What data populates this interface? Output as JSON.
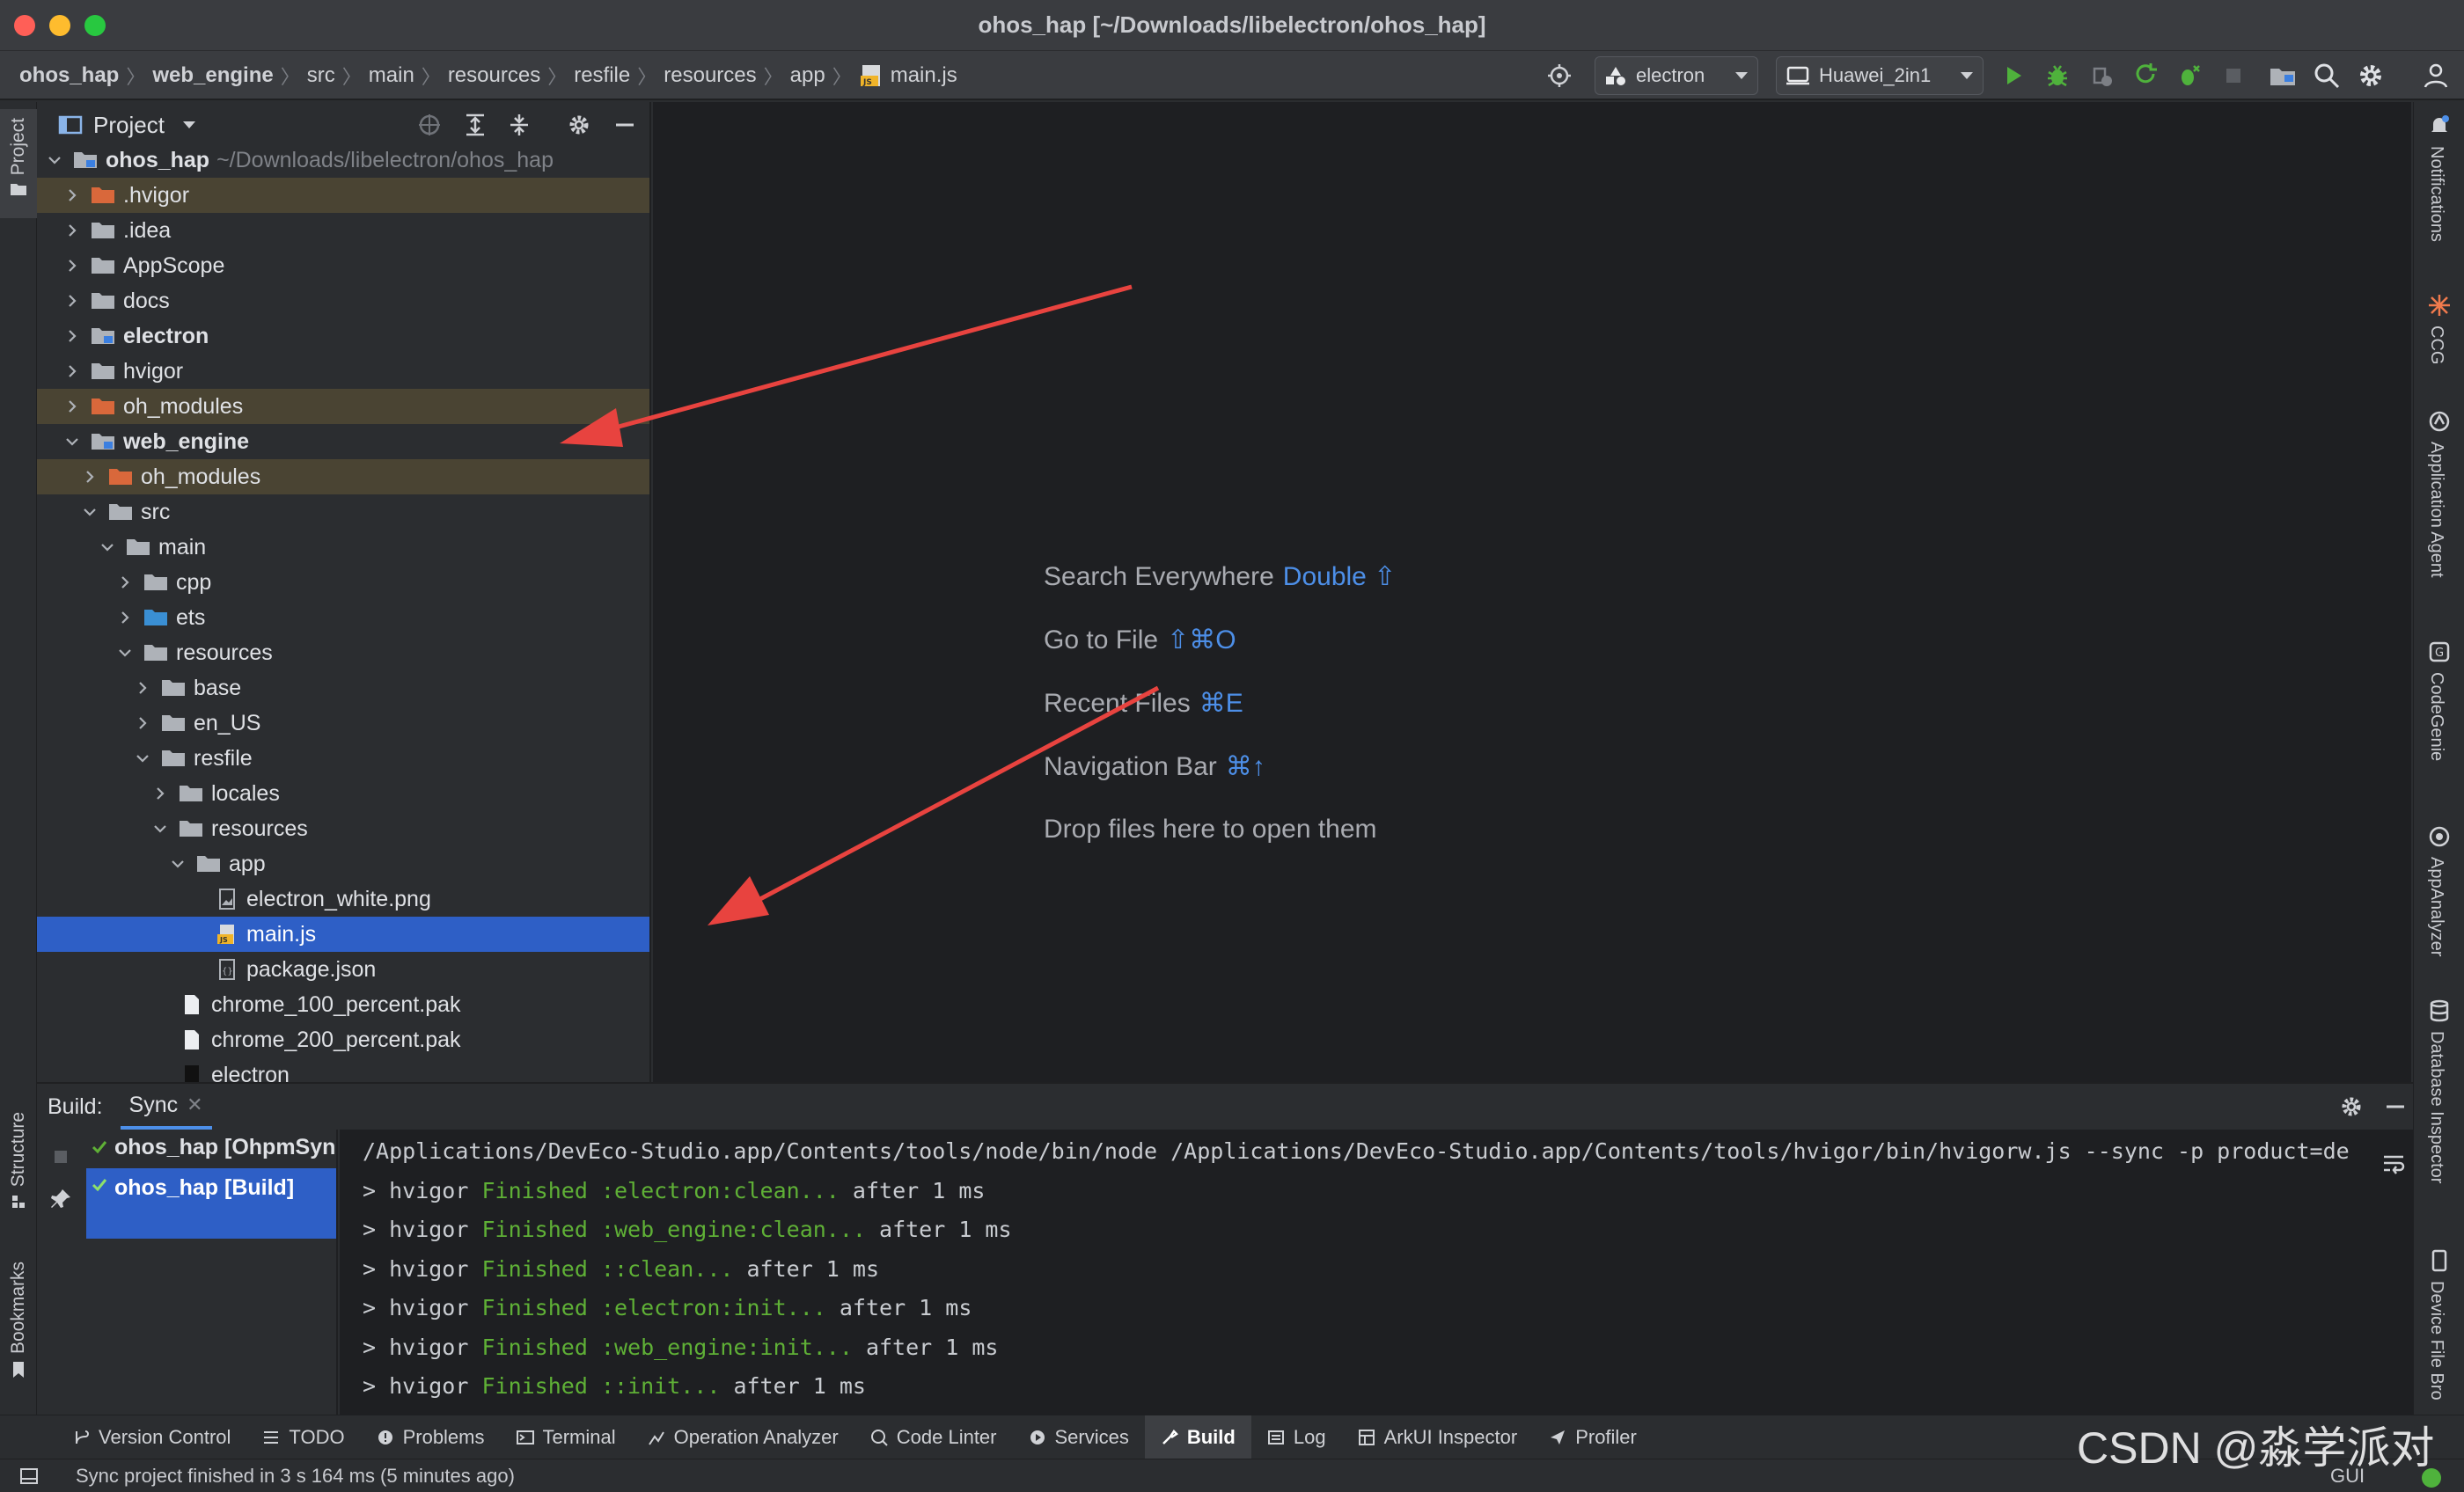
{
  "window": {
    "title": "ohos_hap [~/Downloads/libelectron/ohos_hap]"
  },
  "breadcrumb": [
    "ohos_hap",
    "web_engine",
    "src",
    "main",
    "resources",
    "resfile",
    "resources",
    "app",
    "main.js"
  ],
  "toolbar": {
    "module_combo": "electron",
    "device_combo": "Huawei_2in1"
  },
  "left_stripe": {
    "project": "Project",
    "structure": "Structure",
    "bookmarks": "Bookmarks"
  },
  "project_panel": {
    "title": "Project",
    "tree": [
      {
        "label": "ohos_hap",
        "extra": "~/Downloads/libelectron/ohos_hap",
        "bold": true,
        "expanded": true,
        "kind": "module"
      },
      {
        "label": ".hvigor",
        "kind": "excluded"
      },
      {
        "label": ".idea",
        "kind": "folder"
      },
      {
        "label": "AppScope",
        "kind": "folder"
      },
      {
        "label": "docs",
        "kind": "folder"
      },
      {
        "label": "electron",
        "bold": true,
        "kind": "module"
      },
      {
        "label": "hvigor",
        "kind": "folder"
      },
      {
        "label": "oh_modules",
        "kind": "excluded"
      },
      {
        "label": "web_engine",
        "bold": true,
        "expanded": true,
        "kind": "module"
      },
      {
        "label": "oh_modules",
        "kind": "excluded"
      },
      {
        "label": "src",
        "expanded": true,
        "kind": "folder"
      },
      {
        "label": "main",
        "expanded": true,
        "kind": "folder"
      },
      {
        "label": "cpp",
        "kind": "folder"
      },
      {
        "label": "ets",
        "kind": "source"
      },
      {
        "label": "resources",
        "expanded": true,
        "kind": "folder"
      },
      {
        "label": "base",
        "kind": "folder"
      },
      {
        "label": "en_US",
        "kind": "folder"
      },
      {
        "label": "resfile",
        "expanded": true,
        "kind": "folder"
      },
      {
        "label": "locales",
        "kind": "folder"
      },
      {
        "label": "resources",
        "expanded": true,
        "kind": "folder"
      },
      {
        "label": "app",
        "expanded": true,
        "kind": "folder"
      },
      {
        "label": "electron_white.png",
        "kind": "image"
      },
      {
        "label": "main.js",
        "kind": "js",
        "selected": true
      },
      {
        "label": "package.json",
        "kind": "json"
      },
      {
        "label": "chrome_100_percent.pak",
        "kind": "file"
      },
      {
        "label": "chrome_200_percent.pak",
        "kind": "file"
      },
      {
        "label": "electron",
        "kind": "exec"
      }
    ]
  },
  "editor_hints": [
    {
      "label": "Search Everywhere",
      "shortcut": "Double ⇧"
    },
    {
      "label": "Go to File",
      "shortcut": "⇧⌘O"
    },
    {
      "label": "Recent Files",
      "shortcut": "⌘E"
    },
    {
      "label": "Navigation Bar",
      "shortcut": "⌘↑"
    },
    {
      "label": "Drop files here to open them",
      "shortcut": ""
    }
  ],
  "right_stripe": [
    "Notifications",
    "CCG",
    "Application Agent",
    "CodeGenie",
    "AppAnalyzer",
    "Database Inspector",
    "Device File Bro"
  ],
  "build_panel": {
    "label": "Build:",
    "tab": "Sync",
    "tree": [
      "ohos_hap [OhpmSync]",
      "ohos_hap [Build]"
    ],
    "console": [
      {
        "prefix": "",
        "green": "",
        "rest": "/Applications/DevEco-Studio.app/Contents/tools/node/bin/node /Applications/DevEco-Studio.app/Contents/tools/hvigor/bin/hvigorw.js --sync -p product=de"
      },
      {
        "prefix": "> hvigor ",
        "green": "Finished :electron:clean...",
        "rest": " after 1 ms"
      },
      {
        "prefix": "> hvigor ",
        "green": "Finished :web_engine:clean...",
        "rest": " after 1 ms"
      },
      {
        "prefix": "> hvigor ",
        "green": "Finished ::clean...",
        "rest": " after 1 ms"
      },
      {
        "prefix": "> hvigor ",
        "green": "Finished :electron:init...",
        "rest": " after 1 ms"
      },
      {
        "prefix": "> hvigor ",
        "green": "Finished :web_engine:init...",
        "rest": " after 1 ms"
      },
      {
        "prefix": "> hvigor ",
        "green": "Finished ::init...",
        "rest": " after 1 ms"
      }
    ]
  },
  "tool_windows": [
    "Version Control",
    "TODO",
    "Problems",
    "Terminal",
    "Operation Analyzer",
    "Code Linter",
    "Services",
    "Build",
    "Log",
    "ArkUI Inspector",
    "Profiler"
  ],
  "status_bar": {
    "message": "Sync project finished in 3 s 164 ms (5 minutes ago)",
    "right": "GUI"
  },
  "watermark": "CSDN @淼学派对",
  "colors": {
    "accent": "#4d8fe8",
    "selection": "#2e5fc6",
    "success": "#5fb036",
    "arrow": "#e8433f"
  }
}
